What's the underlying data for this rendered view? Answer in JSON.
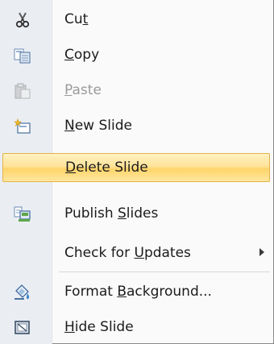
{
  "menu": {
    "items": [
      {
        "pre": "Cu",
        "key": "t",
        "post": "",
        "icon": "scissors-icon",
        "enabled": true,
        "submenu": false,
        "selected": false
      },
      {
        "pre": "",
        "key": "C",
        "post": "opy",
        "icon": "copy-icon",
        "enabled": true,
        "submenu": false,
        "selected": false
      },
      {
        "pre": "",
        "key": "P",
        "post": "aste",
        "icon": "paste-icon",
        "enabled": false,
        "submenu": false,
        "selected": false
      },
      {
        "pre": "",
        "key": "N",
        "post": "ew Slide",
        "icon": "new-slide-icon",
        "enabled": true,
        "submenu": false,
        "selected": false
      },
      {
        "pre": "",
        "key": "D",
        "post": "elete Slide",
        "icon": "",
        "enabled": true,
        "submenu": false,
        "selected": true
      },
      {
        "pre": "Publish ",
        "key": "S",
        "post": "lides",
        "icon": "publish-slides-icon",
        "enabled": true,
        "submenu": false,
        "selected": false
      },
      {
        "pre": "Check for ",
        "key": "U",
        "post": "pdates",
        "icon": "",
        "enabled": true,
        "submenu": true,
        "selected": false
      },
      {
        "pre": "Format ",
        "key": "B",
        "post": "ackground...",
        "icon": "format-background-icon",
        "enabled": true,
        "submenu": false,
        "selected": false
      },
      {
        "pre": "",
        "key": "H",
        "post": "ide Slide",
        "icon": "hide-slide-icon",
        "enabled": true,
        "submenu": false,
        "selected": false
      }
    ]
  },
  "colors": {
    "gutter": "#eaeef3",
    "highlight": "#ffe49a",
    "text": "#1b1b1b",
    "disabled_text": "#9a9a9a"
  }
}
